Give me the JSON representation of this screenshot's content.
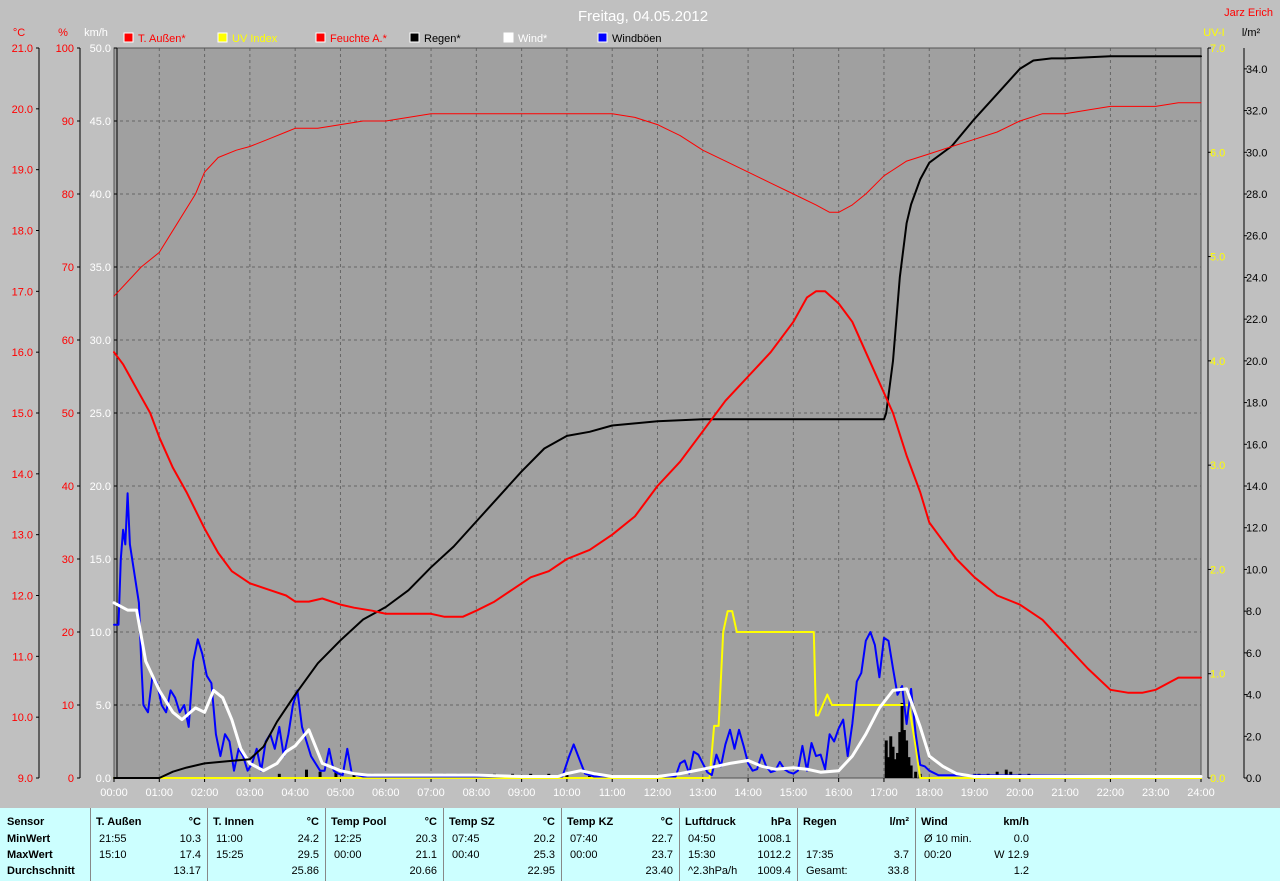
{
  "title": "Freitag, 04.05.2012",
  "author": "Jarz Erich",
  "legend": [
    {
      "label": "T. Außen*",
      "color": "#ff0000",
      "text_color": "#ff0000"
    },
    {
      "label": "UV Index",
      "color": "#ffff00",
      "text_color": "#ffff00"
    },
    {
      "label": "Feuchte A.*",
      "color": "#ff0000",
      "text_color": "#ff0000"
    },
    {
      "label": "Regen*",
      "color": "#000000",
      "text_color": "#000000"
    },
    {
      "label": "Wind*",
      "color": "#ffffff",
      "text_color": "#ffffff"
    },
    {
      "label": "Windböen",
      "color": "#0000ff",
      "text_color": "#000000"
    }
  ],
  "axis_units": {
    "temp": "°C",
    "humidity": "%",
    "wind": "km/h",
    "uv": "UV-I",
    "rain": "l/m²"
  },
  "colors": {
    "background": "#c0c0c0",
    "plot": "#a0a0a0",
    "grid": "#666666",
    "temp": "#ff0000",
    "humidity": "#ff0000",
    "rain": "#000000",
    "wind": "#ffffff",
    "gusts": "#0000ff",
    "uv": "#ffff00",
    "stats_bg": "#ccffff"
  },
  "chart_data": {
    "type": "line",
    "title": "Freitag, 04.05.2012",
    "x_ticks": [
      "00:00",
      "01:00",
      "02:00",
      "03:00",
      "04:00",
      "05:00",
      "06:00",
      "07:00",
      "08:00",
      "09:00",
      "10:00",
      "11:00",
      "12:00",
      "13:00",
      "14:00",
      "15:00",
      "16:00",
      "17:00",
      "18:00",
      "19:00",
      "20:00",
      "21:00",
      "22:00",
      "23:00",
      "24:00"
    ],
    "grid": true,
    "axes": {
      "temp": {
        "label": "°C",
        "range": [
          9.0,
          21.0
        ],
        "ticks": [
          "9.0",
          "10.0",
          "11.0",
          "12.0",
          "13.0",
          "14.0",
          "15.0",
          "16.0",
          "17.0",
          "18.0",
          "19.0",
          "20.0",
          "21.0"
        ]
      },
      "humidity": {
        "label": "%",
        "range": [
          0,
          100
        ],
        "ticks": [
          "0",
          "10",
          "20",
          "30",
          "40",
          "50",
          "60",
          "70",
          "80",
          "90",
          "100"
        ]
      },
      "wind": {
        "label": "km/h",
        "range": [
          0,
          50
        ],
        "ticks": [
          "0.0",
          "5.0",
          "10.0",
          "15.0",
          "20.0",
          "25.0",
          "30.0",
          "35.0",
          "40.0",
          "45.0",
          "50.0"
        ]
      },
      "uv": {
        "label": "UV-I",
        "range": [
          0,
          7
        ],
        "ticks": [
          "0.0",
          "1.0",
          "2.0",
          "3.0",
          "4.0",
          "5.0",
          "6.0",
          "7.0"
        ]
      },
      "rain": {
        "label": "l/m²",
        "range": [
          0,
          35
        ],
        "ticks": [
          "0.0",
          "2.0",
          "4.0",
          "6.0",
          "8.0",
          "10.0",
          "12.0",
          "14.0",
          "16.0",
          "18.0",
          "20.0",
          "22.0",
          "24.0",
          "26.0",
          "28.0",
          "30.0",
          "32.0",
          "34.0"
        ]
      }
    },
    "series": [
      {
        "name": "T. Außen*",
        "axis": "temp",
        "color": "#ff0000",
        "x": [
          0,
          0.2,
          0.5,
          0.8,
          1.0,
          1.3,
          1.6,
          2.0,
          2.3,
          2.6,
          3.0,
          3.4,
          3.8,
          4.0,
          4.3,
          4.6,
          5.0,
          5.3,
          5.7,
          6.0,
          6.5,
          7.0,
          7.3,
          7.7,
          8.0,
          8.4,
          8.8,
          9.2,
          9.6,
          10.0,
          10.5,
          11.0,
          11.5,
          12.0,
          12.5,
          13.0,
          13.5,
          14.0,
          14.5,
          15.0,
          15.3,
          15.5,
          15.7,
          16.0,
          16.3,
          16.6,
          16.9,
          17.2,
          17.5,
          17.8,
          18.0,
          18.3,
          18.6,
          19.0,
          19.5,
          20.0,
          20.5,
          21.0,
          21.5,
          22.0,
          22.4,
          22.7,
          23.0,
          23.5,
          24.0
        ],
        "values": [
          16.0,
          15.8,
          15.4,
          15.0,
          14.6,
          14.1,
          13.7,
          13.1,
          12.7,
          12.4,
          12.2,
          12.1,
          12.0,
          11.9,
          11.9,
          11.95,
          11.85,
          11.8,
          11.75,
          11.7,
          11.7,
          11.7,
          11.65,
          11.65,
          11.75,
          11.9,
          12.1,
          12.3,
          12.4,
          12.6,
          12.75,
          13.0,
          13.3,
          13.8,
          14.2,
          14.7,
          15.2,
          15.6,
          16.0,
          16.5,
          16.9,
          17.0,
          17.0,
          16.8,
          16.5,
          16.0,
          15.5,
          15.0,
          14.3,
          13.7,
          13.2,
          12.9,
          12.6,
          12.3,
          12.0,
          11.85,
          11.6,
          11.2,
          10.8,
          10.45,
          10.4,
          10.4,
          10.45,
          10.65,
          10.65
        ]
      },
      {
        "name": "Feuchte A.*",
        "axis": "humidity",
        "color": "#ff0000",
        "x": [
          0,
          0.3,
          0.6,
          1.0,
          1.4,
          1.8,
          2.0,
          2.3,
          2.7,
          3.0,
          3.4,
          3.8,
          4.0,
          4.5,
          5.0,
          5.5,
          6.0,
          6.5,
          7.0,
          7.5,
          8.0,
          9.0,
          10.0,
          11.0,
          11.5,
          12.0,
          12.5,
          13.0,
          13.5,
          14.0,
          14.5,
          15.0,
          15.5,
          15.8,
          16.0,
          16.3,
          16.6,
          17.0,
          17.5,
          18.0,
          18.5,
          19.0,
          19.5,
          20.0,
          20.5,
          21.0,
          21.5,
          22.0,
          22.5,
          23.0,
          23.5,
          24.0
        ],
        "values": [
          66,
          68,
          70,
          72,
          76,
          80,
          83,
          85,
          86,
          86.5,
          87.5,
          88.5,
          89,
          89,
          89.5,
          90,
          90,
          90.5,
          91,
          91,
          91,
          91,
          91,
          91,
          90.5,
          89.5,
          88,
          86,
          84.5,
          83,
          81.5,
          80,
          78.5,
          77.5,
          77.5,
          78.5,
          80,
          82.5,
          84.5,
          85.5,
          86.5,
          87.5,
          88.5,
          90,
          91,
          91,
          91.5,
          92,
          92,
          92,
          92.5,
          92.5
        ]
      },
      {
        "name": "Regen*",
        "axis": "rain",
        "color": "#000000",
        "x": [
          0,
          1.0,
          1.3,
          1.6,
          2.0,
          2.5,
          3.0,
          3.3,
          3.6,
          4.0,
          4.5,
          5.0,
          5.5,
          6.0,
          6.5,
          7.0,
          7.5,
          8.0,
          8.5,
          9.0,
          9.5,
          10.0,
          10.5,
          11.0,
          11.5,
          12.0,
          13.0,
          14.0,
          15.0,
          16.0,
          17.0,
          17.05,
          17.2,
          17.35,
          17.5,
          17.6,
          17.8,
          18.0,
          18.5,
          19.0,
          19.5,
          20.0,
          20.3,
          20.7,
          21.0,
          22.0,
          23.0,
          24.0
        ],
        "values": [
          0,
          0,
          0.3,
          0.5,
          0.7,
          0.8,
          0.9,
          1.5,
          2.7,
          4.0,
          5.5,
          6.6,
          7.6,
          8.2,
          9.0,
          10.1,
          11.1,
          12.3,
          13.5,
          14.7,
          15.8,
          16.4,
          16.6,
          16.9,
          17.0,
          17.1,
          17.2,
          17.2,
          17.2,
          17.2,
          17.2,
          17.5,
          20.0,
          24.0,
          26.6,
          27.5,
          28.7,
          29.5,
          30.3,
          31.6,
          32.8,
          34.0,
          34.4,
          34.5,
          34.5,
          34.6,
          34.6,
          34.6
        ]
      },
      {
        "name": "Wind*",
        "axis": "wind",
        "color": "#ffffff",
        "x": [
          0,
          0.3,
          0.5,
          0.7,
          1.0,
          1.3,
          1.5,
          1.8,
          2.0,
          2.2,
          2.4,
          2.6,
          2.8,
          3.0,
          3.3,
          3.6,
          3.8,
          4.0,
          4.3,
          4.6,
          5.0,
          5.3,
          5.6,
          6.0,
          7.0,
          8.0,
          9.0,
          9.8,
          10.0,
          10.3,
          10.6,
          11.0,
          12.0,
          12.5,
          13.0,
          13.3,
          13.6,
          14.0,
          14.3,
          14.6,
          15.0,
          15.3,
          15.6,
          16.0,
          16.3,
          16.6,
          16.9,
          17.2,
          17.5,
          17.8,
          18.0,
          18.3,
          18.6,
          19.0,
          20.0,
          24.0
        ],
        "values": [
          12.0,
          11.5,
          11.5,
          8.0,
          6.0,
          4.5,
          4.0,
          4.8,
          4.5,
          6.0,
          5.5,
          4.0,
          2.0,
          1.0,
          0.5,
          1.0,
          1.8,
          2.2,
          3.3,
          1.0,
          0.5,
          0.3,
          0.2,
          0.2,
          0.2,
          0.2,
          0.1,
          0.1,
          0.3,
          0.5,
          0.3,
          0.1,
          0.1,
          0.3,
          0.6,
          0.8,
          1.0,
          1.2,
          0.8,
          0.6,
          0.7,
          0.6,
          0.4,
          0.5,
          1.5,
          3.0,
          4.8,
          6.0,
          6.1,
          3.5,
          1.5,
          0.8,
          0.3,
          0.1,
          0.1,
          0.1
        ]
      },
      {
        "name": "Windböen",
        "axis": "wind",
        "color": "#0000ff",
        "x": [
          0,
          0.1,
          0.15,
          0.2,
          0.25,
          0.3,
          0.35,
          0.45,
          0.55,
          0.6,
          0.65,
          0.75,
          0.85,
          0.95,
          1.05,
          1.15,
          1.25,
          1.35,
          1.45,
          1.55,
          1.65,
          1.75,
          1.85,
          1.95,
          2.05,
          2.15,
          2.25,
          2.35,
          2.45,
          2.55,
          2.65,
          2.75,
          2.85,
          2.95,
          3.05,
          3.15,
          3.25,
          3.35,
          3.45,
          3.55,
          3.65,
          3.75,
          3.85,
          3.95,
          4.05,
          4.15,
          4.25,
          4.35,
          4.45,
          4.55,
          4.65,
          4.75,
          4.85,
          4.95,
          5.05,
          5.15,
          5.25,
          5.5,
          9.9,
          10.05,
          10.15,
          10.25,
          10.4,
          10.6,
          12.4,
          12.5,
          12.6,
          12.7,
          12.8,
          12.9,
          13.0,
          13.1,
          13.2,
          13.3,
          13.4,
          13.5,
          13.6,
          13.7,
          13.8,
          13.9,
          14.0,
          14.1,
          14.2,
          14.3,
          14.4,
          14.5,
          14.6,
          14.7,
          14.8,
          14.9,
          15.0,
          15.1,
          15.2,
          15.3,
          15.4,
          15.5,
          15.6,
          15.7,
          15.8,
          15.9,
          16.0,
          16.1,
          16.2,
          16.3,
          16.4,
          16.5,
          16.6,
          16.7,
          16.8,
          16.9,
          17.0,
          17.1,
          17.2,
          17.3,
          17.4,
          17.5,
          17.6,
          17.7,
          17.8,
          17.9,
          18.0,
          18.2,
          24.0
        ],
        "values": [
          10.5,
          10.5,
          15.0,
          17.0,
          16.0,
          19.5,
          16.0,
          14.0,
          12.0,
          8.0,
          5.0,
          4.5,
          7.0,
          6.5,
          5.0,
          4.5,
          6.0,
          5.5,
          4.5,
          5.0,
          3.5,
          8.0,
          9.5,
          8.5,
          7.0,
          6.5,
          3.0,
          1.5,
          3.0,
          2.5,
          0.5,
          2.0,
          1.5,
          0.5,
          1.0,
          2.0,
          0.5,
          2.5,
          3.0,
          2.0,
          3.5,
          1.5,
          3.0,
          5.0,
          6.0,
          3.5,
          2.5,
          1.5,
          1.0,
          0.5,
          0.5,
          2.0,
          0.5,
          0.3,
          0.2,
          2.0,
          0.3,
          0.1,
          0.1,
          1.5,
          2.3,
          1.5,
          0.3,
          0.1,
          0.1,
          1.0,
          1.2,
          0.3,
          1.8,
          1.6,
          1.0,
          0.4,
          0.2,
          1.6,
          0.8,
          2.3,
          3.3,
          2.0,
          3.3,
          2.2,
          1.0,
          0.5,
          0.6,
          1.6,
          0.8,
          0.4,
          0.5,
          1.1,
          0.6,
          0.4,
          0.3,
          0.5,
          2.2,
          0.5,
          2.4,
          1.5,
          1.6,
          0.6,
          3.0,
          2.5,
          3.4,
          4.0,
          1.5,
          3.7,
          6.6,
          7.2,
          9.4,
          10.0,
          9.1,
          6.9,
          9.6,
          9.4,
          7.5,
          5.7,
          6.3,
          3.7,
          6.1,
          3.0,
          0.9,
          0.8,
          0.5,
          0.2,
          0.1
        ]
      },
      {
        "name": "UV Index",
        "axis": "uv",
        "color": "#ffff00",
        "x": [
          0,
          13.15,
          13.25,
          13.35,
          13.45,
          13.55,
          13.65,
          13.75,
          13.85,
          15.45,
          15.5,
          15.55,
          15.65,
          15.75,
          15.85,
          15.95,
          16.05,
          16.15,
          17.0,
          17.55,
          17.7,
          17.8,
          24.0
        ],
        "values": [
          0,
          0,
          0.5,
          0.5,
          1.4,
          1.6,
          1.6,
          1.4,
          1.4,
          1.4,
          0.6,
          0.6,
          0.7,
          0.8,
          0.7,
          0.7,
          0.7,
          0.7,
          0.7,
          0.7,
          0.3,
          0,
          0
        ]
      },
      {
        "name": "Regen (Menge)",
        "axis": "rain",
        "color": "#000000",
        "type": "bar",
        "x": [
          3.65,
          4.25,
          4.55,
          4.9,
          5.3,
          5.7,
          6.8,
          7.0,
          7.3,
          7.6,
          8.0,
          8.4,
          8.8,
          9.2,
          9.6,
          10.0,
          10.5,
          11.0,
          17.05,
          17.1,
          17.15,
          17.2,
          17.25,
          17.3,
          17.35,
          17.4,
          17.45,
          17.5,
          17.55,
          17.6,
          17.7,
          17.8,
          19.0,
          19.1,
          19.3,
          19.5,
          19.7,
          19.8,
          20.0,
          20.2
        ],
        "values": [
          0.2,
          0.4,
          0.3,
          0.3,
          0.2,
          0.2,
          0.1,
          0.2,
          0.2,
          0.2,
          0.2,
          0.2,
          0.2,
          0.2,
          0.2,
          0.2,
          0.1,
          0.1,
          1.8,
          1.0,
          2.0,
          1.5,
          0.9,
          1.2,
          2.2,
          3.6,
          2.3,
          1.8,
          1.0,
          0.6,
          0.3,
          0.2,
          0.2,
          0.2,
          0.2,
          0.3,
          0.4,
          0.3,
          0.2,
          0.2
        ]
      }
    ]
  },
  "stats": {
    "sensor": {
      "header": "Sensor",
      "rows": [
        "MinWert",
        "MaxWert",
        "Durchschnitt"
      ]
    },
    "groups": [
      {
        "name": "T. Außen",
        "unit": "°C",
        "min": [
          "21:55",
          "10.3"
        ],
        "max": [
          "15:10",
          "17.4"
        ],
        "avg": [
          "",
          "13.17"
        ]
      },
      {
        "name": "T. Innen",
        "unit": "°C",
        "min": [
          "11:00",
          "24.2"
        ],
        "max": [
          "15:25",
          "29.5"
        ],
        "avg": [
          "",
          "25.86"
        ]
      },
      {
        "name": "Temp Pool",
        "unit": "°C",
        "min": [
          "12:25",
          "20.3"
        ],
        "max": [
          "00:00",
          "21.1"
        ],
        "avg": [
          "",
          "20.66"
        ]
      },
      {
        "name": "Temp SZ",
        "unit": "°C",
        "min": [
          "07:45",
          "20.2"
        ],
        "max": [
          "00:40",
          "25.3"
        ],
        "avg": [
          "",
          "22.95"
        ]
      },
      {
        "name": "Temp KZ",
        "unit": "°C",
        "min": [
          "07:40",
          "22.7"
        ],
        "max": [
          "00:00",
          "23.7"
        ],
        "avg": [
          "",
          "23.40"
        ]
      },
      {
        "name": "Luftdruck",
        "unit": "hPa",
        "min": [
          "04:50",
          "1008.1"
        ],
        "max": [
          "15:30",
          "1012.2"
        ],
        "avg": [
          "^2.3hPa/h",
          "1009.4"
        ]
      },
      {
        "name": "Regen",
        "unit": "l/m²",
        "min": [
          "",
          ""
        ],
        "max": [
          "17:35",
          "3.7"
        ],
        "avg": [
          "Gesamt:",
          "33.8"
        ]
      },
      {
        "name": "Wind",
        "unit": "km/h",
        "min": [
          "Ø 10 min.",
          "0.0"
        ],
        "max": [
          "00:20",
          "W 12.9"
        ],
        "avg": [
          "",
          "1.2"
        ]
      }
    ]
  }
}
